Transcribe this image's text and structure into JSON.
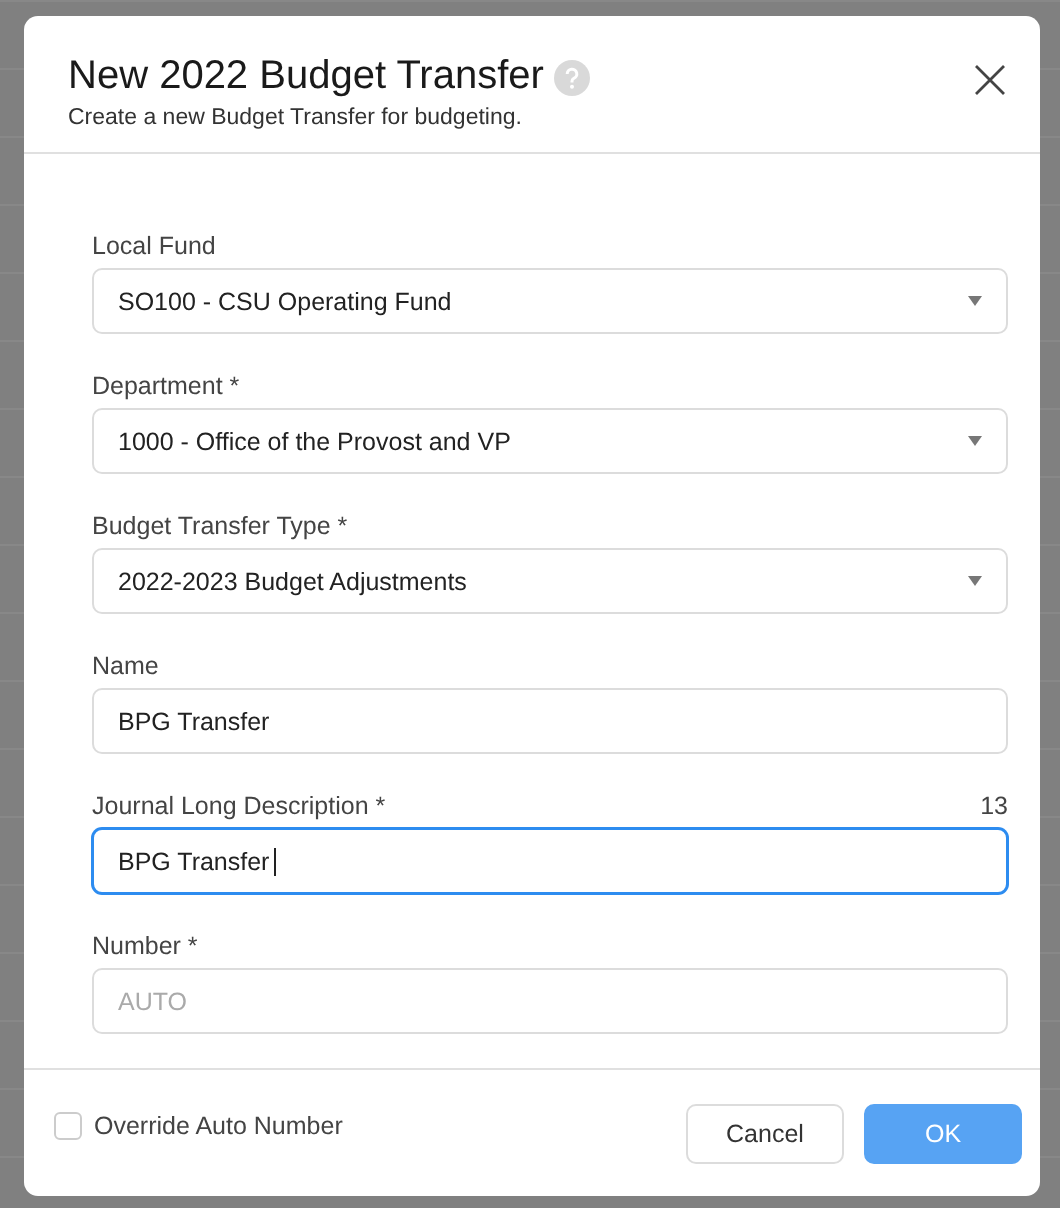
{
  "dialog": {
    "title": "New 2022 Budget Transfer",
    "subtitle": "Create a new Budget Transfer for budgeting.",
    "fields": [
      {
        "kind": "select",
        "label": "Local Fund",
        "value": "SO100 - CSU Operating Fund",
        "focused": false
      },
      {
        "kind": "select",
        "label": "Department *",
        "value": "1000 - Office of the Provost and VP",
        "focused": false
      },
      {
        "kind": "select",
        "label": "Budget Transfer Type *",
        "value": "2022-2023 Budget Adjustments",
        "focused": false
      },
      {
        "kind": "text",
        "label": "Name",
        "value": "BPG Transfer",
        "focused": false
      },
      {
        "kind": "text",
        "label": "Journal Long Description *",
        "value": "BPG Transfer",
        "counter": "13",
        "focused": true
      },
      {
        "kind": "text",
        "label": "Number *",
        "placeholder": "AUTO",
        "focused": false
      }
    ],
    "override": {
      "label": "Override Auto Number",
      "checked": false
    },
    "buttons": [
      {
        "kind": "secondary",
        "label": "Cancel"
      },
      {
        "kind": "primary",
        "label": "OK"
      }
    ]
  }
}
